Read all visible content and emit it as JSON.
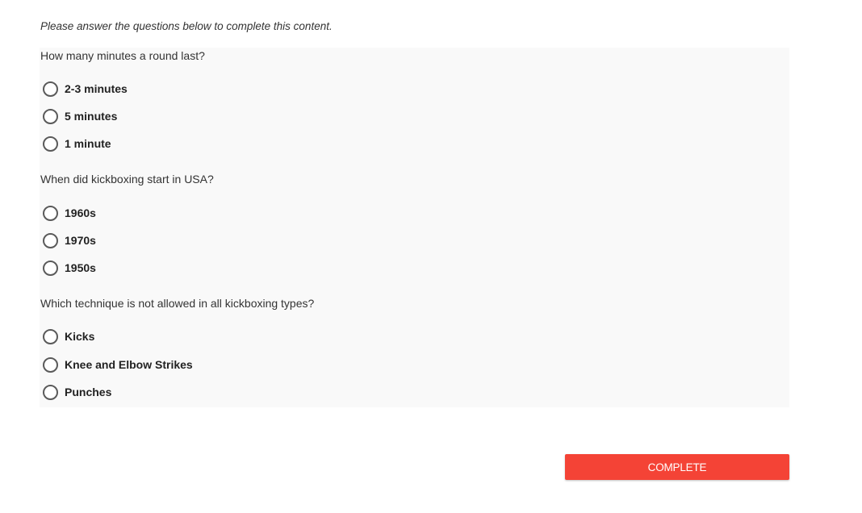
{
  "instruction": "Please answer the questions below to complete this content.",
  "questions": [
    {
      "text": "How many minutes a round last?",
      "options": [
        "2-3 minutes",
        "5 minutes",
        "1 minute"
      ]
    },
    {
      "text": "When did kickboxing start in USA?",
      "options": [
        "1960s",
        "1970s",
        "1950s"
      ]
    },
    {
      "text": "Which technique is not allowed in all kickboxing types?",
      "options": [
        "Kicks",
        "Knee and Elbow Strikes",
        "Punches"
      ]
    }
  ],
  "complete_button": {
    "label": "COMPLETE",
    "color": "#f44336"
  },
  "colors": {
    "panel_background": "#f9f9f9",
    "text": "#333333"
  }
}
